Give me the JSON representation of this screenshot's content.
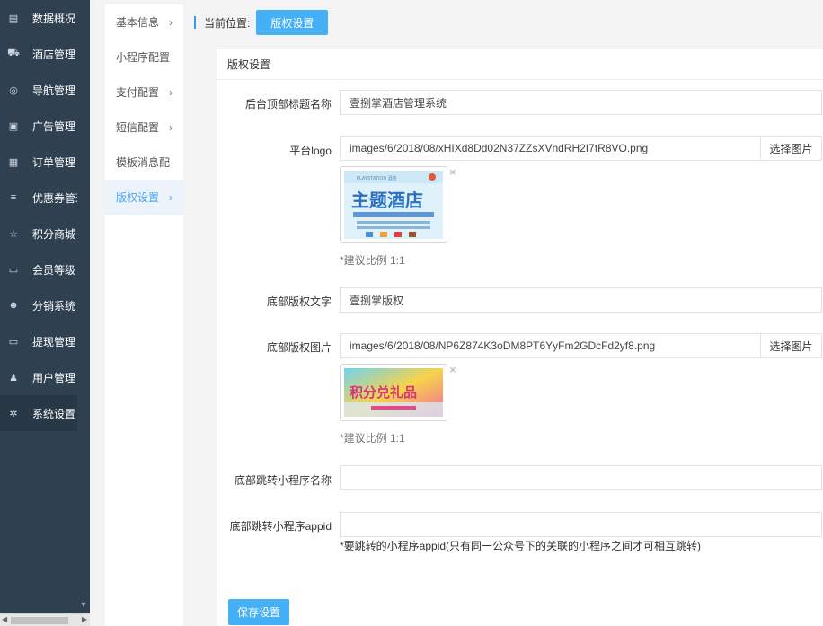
{
  "sidebar": {
    "items": [
      {
        "label": "数据概况",
        "icon": "dashboard-icon"
      },
      {
        "label": "酒店管理",
        "icon": "cart-icon"
      },
      {
        "label": "导航管理",
        "icon": "compass-icon"
      },
      {
        "label": "广告管理",
        "icon": "gift-icon"
      },
      {
        "label": "订单管理",
        "icon": "server-icon"
      },
      {
        "label": "优惠券管理",
        "icon": "list-icon"
      },
      {
        "label": "积分商城",
        "icon": "star-icon"
      },
      {
        "label": "会员等级",
        "icon": "money-icon"
      },
      {
        "label": "分销系统",
        "icon": "users-icon"
      },
      {
        "label": "提现管理",
        "icon": "money-icon"
      },
      {
        "label": "用户管理",
        "icon": "user-icon"
      },
      {
        "label": "系统设置",
        "icon": "gear-icon"
      }
    ],
    "active_index": 11
  },
  "submenu": {
    "items": [
      {
        "label": "基本信息",
        "arrow": "›"
      },
      {
        "label": "小程序配置",
        "arrow": ""
      },
      {
        "label": "支付配置",
        "arrow": "›"
      },
      {
        "label": "短信配置",
        "arrow": "›"
      },
      {
        "label": "模板消息配",
        "arrow": ""
      },
      {
        "label": "版权设置",
        "arrow": "›"
      }
    ],
    "active_index": 5
  },
  "breadcrumb": {
    "label": "当前位置:",
    "current": "版权设置"
  },
  "panel": {
    "title": "版权设置"
  },
  "form": {
    "top_title": {
      "label": "后台顶部标题名称",
      "value": "壹捌掌酒店管理系统"
    },
    "logo": {
      "label": "平台logo",
      "value": "images/6/2018/08/xHIXd8Dd02N37ZZsXVndRH2I7tR8VO.png",
      "button": "选择图片",
      "hint": "*建议比例 1:1",
      "preview_title": "主题酒店",
      "preview_badge": "PLAYSTATION 酒店"
    },
    "copyright_text": {
      "label": "底部版权文字",
      "value": "壹捌掌版权"
    },
    "copyright_image": {
      "label": "底部版权图片",
      "value": "images/6/2018/08/NP6Z874K3oDM8PT6YyFm2GDcFd2yf8.png",
      "button": "选择图片",
      "hint": "*建议比例 1:1",
      "preview_title": "积分兑礼品"
    },
    "mini_name": {
      "label": "底部跳转小程序名称",
      "value": ""
    },
    "mini_appid": {
      "label": "底部跳转小程序appid",
      "value": "",
      "hint": "*要跳转的小程序appid(只有同一公众号下的关联的小程序之间才可相互跳转)"
    },
    "delete_glyph": "×"
  },
  "save_button": "保存设置",
  "colors": {
    "sidebar_bg": "#2f4050",
    "accent": "#45b0f5"
  }
}
